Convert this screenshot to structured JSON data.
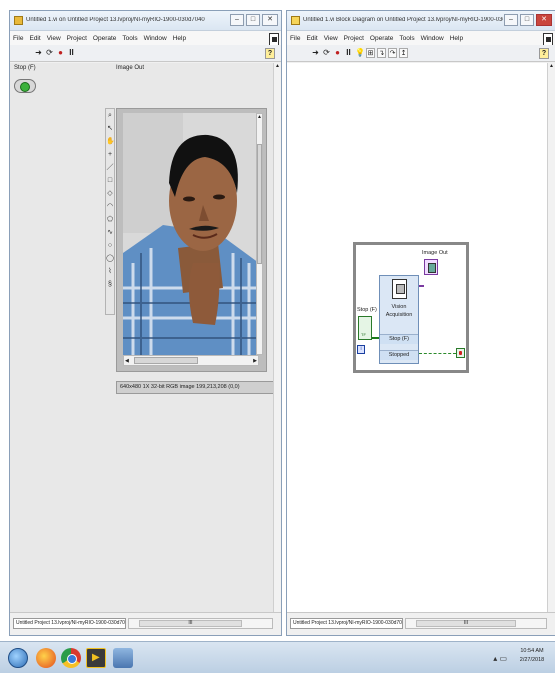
{
  "front_panel": {
    "title": "Untitled 1.vi on Untitled Project 13.lvproj/NI-myRIO-1900-030d7040",
    "menu": [
      "File",
      "Edit",
      "View",
      "Project",
      "Operate",
      "Tools",
      "Window",
      "Help"
    ],
    "stop_label": "Stop (F)",
    "image_label": "Image Out",
    "image_info": "640x480 1X 32-bit RGB image 199,213,208    (0,0)",
    "project_path": "Untitled Project 13.lvproj/NI-myRIO-1900-030d7040",
    "scroll_value": "III"
  },
  "block_diagram": {
    "title": "Untitled 1.vi Block Diagram on Untitled Project 13.lvproj/NI-myRIO-1900-030d7040",
    "menu": [
      "File",
      "Edit",
      "View",
      "Project",
      "Operate",
      "Tools",
      "Window",
      "Help"
    ],
    "stop_label": "Stop (F)",
    "image_label": "Image Out",
    "express_vi_name": "Vision Acquisition",
    "terminal_stop": "Stop (F)",
    "terminal_stopped": "Stopped",
    "iteration": "i",
    "project_path": "Untitled Project 13.lvproj/NI-myRIO-1900-030d7040",
    "scroll_value": "III"
  },
  "taskbar": {
    "time": "10:54 AM",
    "date": "2/27/2018"
  },
  "icons": {
    "run": "run-arrow-icon",
    "run_continuous": "run-continuous-icon",
    "abort": "abort-icon",
    "pause": "pause-icon",
    "help": "context-help-icon"
  }
}
